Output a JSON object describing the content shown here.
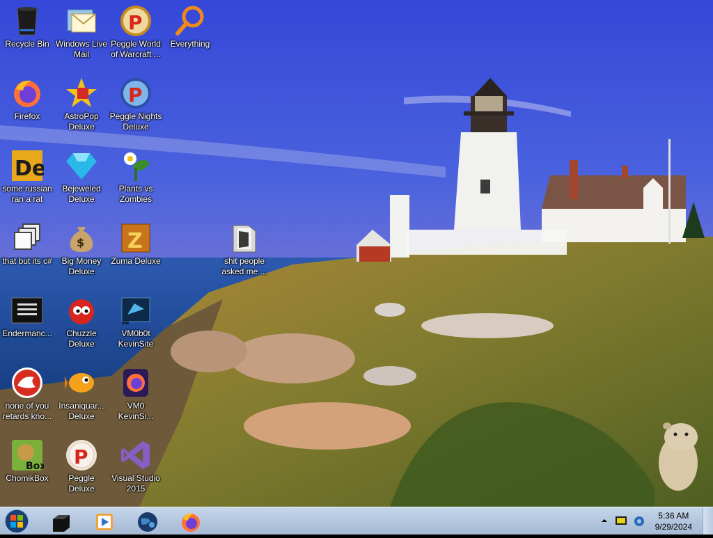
{
  "desktop": {
    "icons": [
      {
        "label": "Recycle Bin",
        "icon": "recycle-bin-icon"
      },
      {
        "label": "Windows Live\nMail",
        "icon": "mail-icon"
      },
      {
        "label": "Peggle World\nof Warcraft ...",
        "icon": "peggle-icon"
      },
      {
        "label": "Everything",
        "icon": "search-icon"
      },
      {
        "label": "Firefox",
        "icon": "firefox-icon"
      },
      {
        "label": "AstroPop\nDeluxe",
        "icon": "astropop-icon"
      },
      {
        "label": "Peggle Nights\nDeluxe",
        "icon": "peggle-nights-icon"
      },
      {
        "label": "some russian\nran a rat",
        "icon": "de-icon"
      },
      {
        "label": "Bejeweled\nDeluxe",
        "icon": "gem-icon"
      },
      {
        "label": "Plants vs\nZombies",
        "icon": "plant-icon"
      },
      {
        "label": "that but its c#",
        "icon": "windows-stack-icon"
      },
      {
        "label": "Big Money\nDeluxe",
        "icon": "money-bag-icon"
      },
      {
        "label": "Zuma Deluxe",
        "icon": "zuma-icon"
      },
      {
        "label": "shit people\nasked me ...",
        "icon": "folder-icon"
      },
      {
        "label": "Endermanc...",
        "icon": "console-icon"
      },
      {
        "label": "Chuzzle\nDeluxe",
        "icon": "chuzzle-icon"
      },
      {
        "label": "VM0b0t\nKevinSite",
        "icon": "vm-icon"
      },
      {
        "label": "none of you\nretards kno...",
        "icon": "rat-icon"
      },
      {
        "label": "Insaniquar...\nDeluxe",
        "icon": "fish-icon"
      },
      {
        "label": "VM0\nKevinSi...",
        "icon": "firefox-dev-icon"
      },
      {
        "label": "ChomikBox",
        "icon": "hamster-box-icon"
      },
      {
        "label": "Peggle Deluxe",
        "icon": "peggle-icon"
      },
      {
        "label": "Visual Studio\n2015",
        "icon": "visual-studio-icon"
      }
    ]
  },
  "taskbar": {
    "start": "start-orb-icon",
    "pinned": [
      {
        "name": "terminal-icon"
      },
      {
        "name": "media-player-icon"
      },
      {
        "name": "globe-icon"
      },
      {
        "name": "firefox-icon"
      }
    ],
    "tray": {
      "time": "5:36 AM",
      "date": "9/29/2024"
    }
  },
  "colors": {
    "sky_top": "#3a4fd6",
    "sky_bottom": "#9a86c8",
    "sea": "#1f4f9c",
    "grass": "#8a7a2a",
    "taskbar": "#b3c6de"
  }
}
